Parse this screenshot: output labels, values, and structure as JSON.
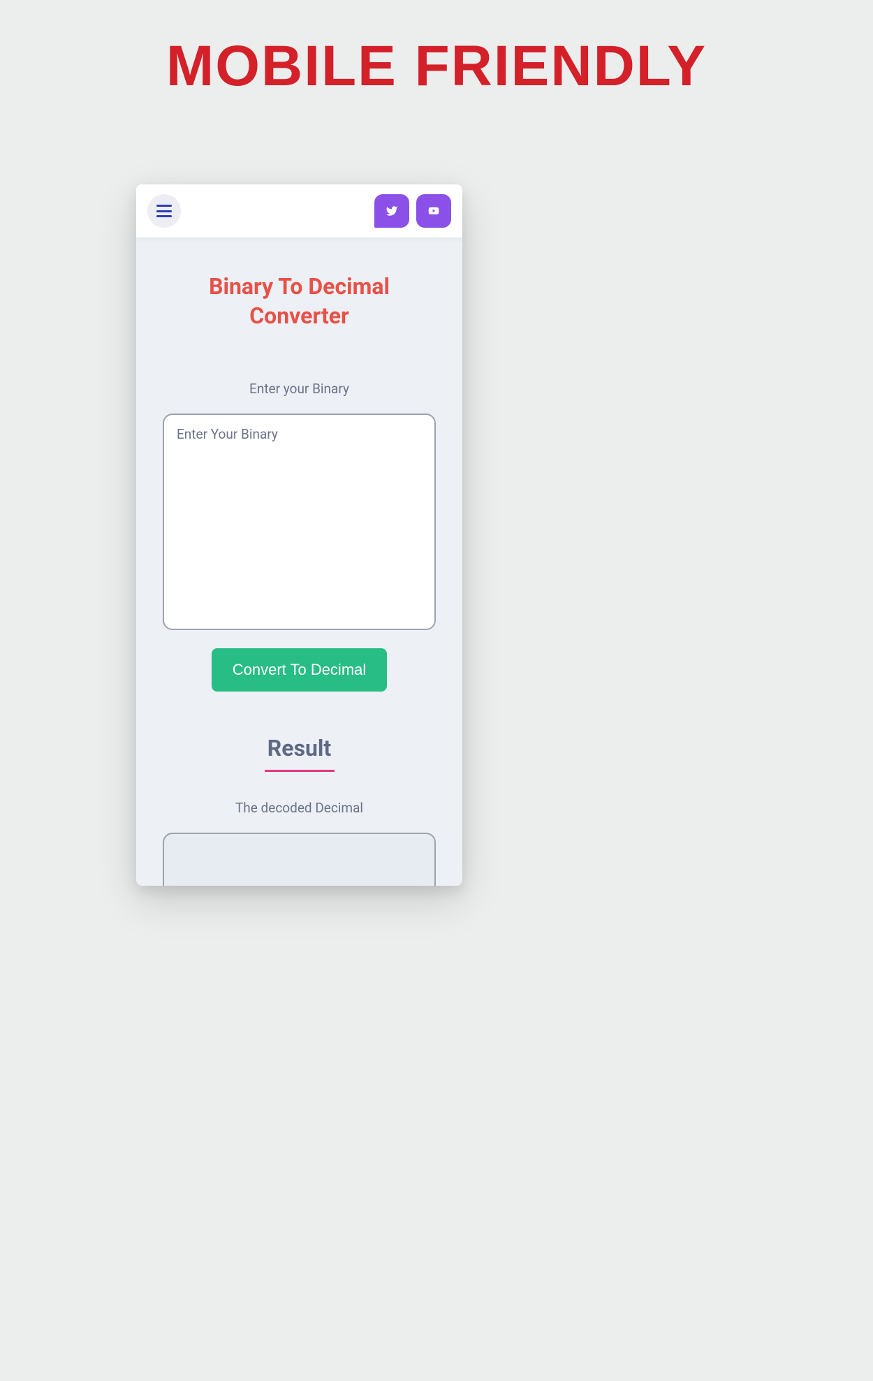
{
  "banner": {
    "title": "MOBILE FRIENDLY"
  },
  "app": {
    "header": {
      "menu_icon": "hamburger-menu",
      "social": {
        "twitter_icon": "twitter",
        "youtube_icon": "youtube"
      }
    },
    "main_title": "Binary To Decimal Converter",
    "input": {
      "label": "Enter your Binary",
      "placeholder": "Enter Your Binary",
      "value": ""
    },
    "convert_button_label": "Convert To Decimal",
    "result": {
      "title": "Result",
      "label": "The decoded Decimal",
      "value": ""
    }
  },
  "colors": {
    "banner_text": "#d32029",
    "title_text": "#e85147",
    "label_text": "#6b7388",
    "button_bg": "#27bd85",
    "social_bg": "#8a50e8",
    "menu_icon": "#2d3db4",
    "underline": "#e8367f"
  }
}
